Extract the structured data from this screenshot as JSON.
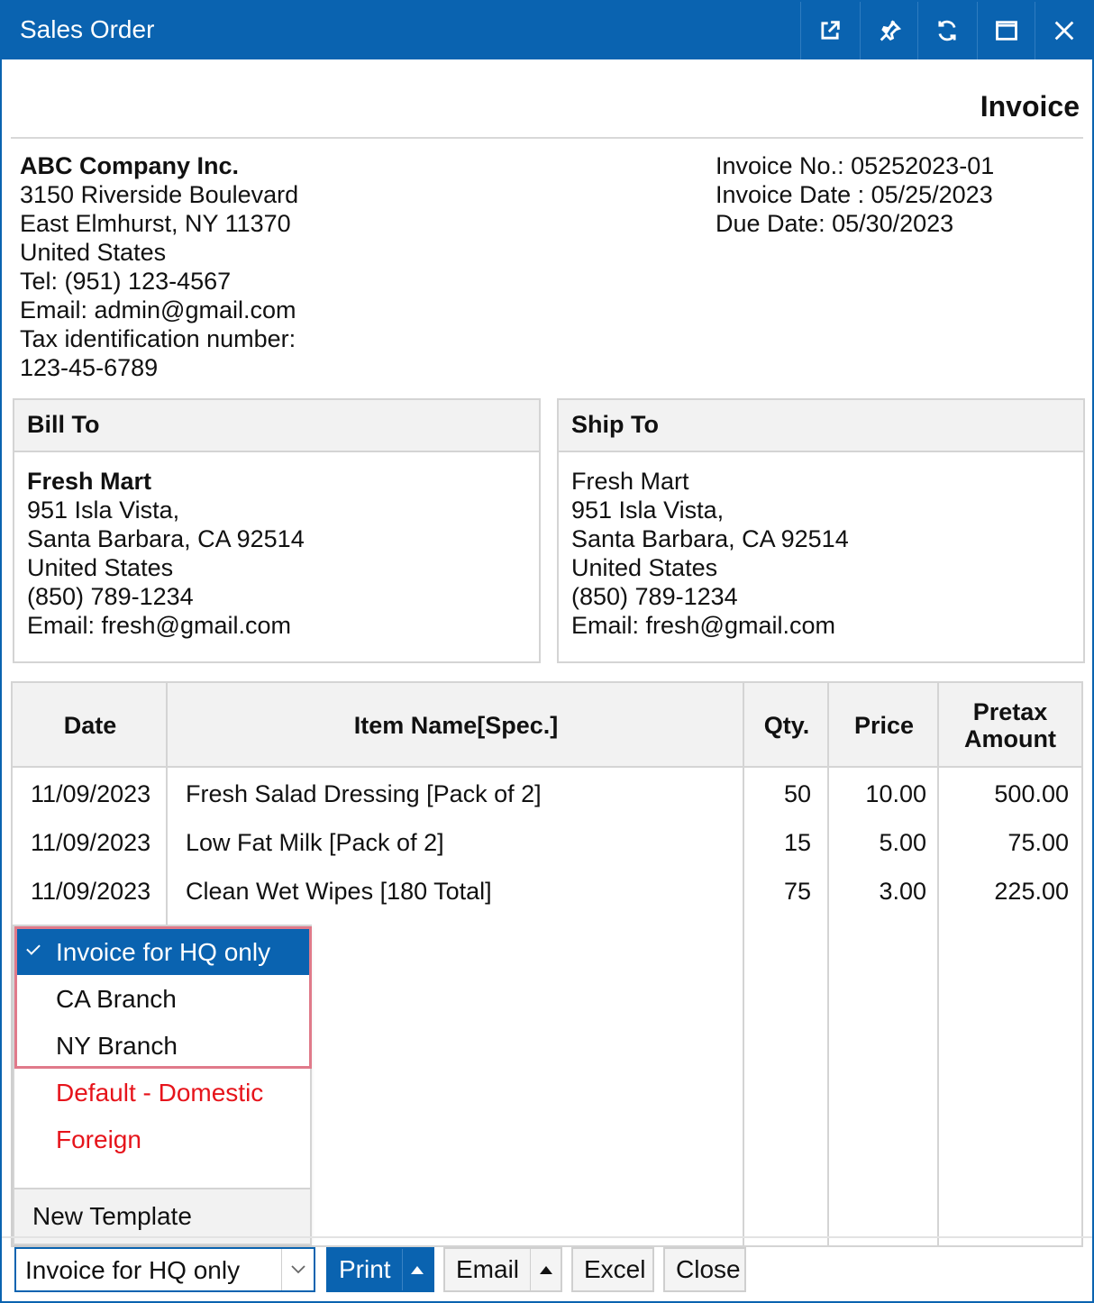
{
  "window": {
    "title": "Sales Order"
  },
  "document": {
    "title": "Invoice"
  },
  "company": {
    "name": "ABC Company Inc.",
    "lines": [
      "3150 Riverside Boulevard",
      "East Elmhurst, NY 11370",
      "United States",
      "Tel: (951) 123-4567",
      "Email: admin@gmail.com",
      "Tax identification number:",
      "123-45-6789"
    ]
  },
  "invoice_info": [
    "Invoice No.: 05252023-01",
    "Invoice Date : 05/25/2023",
    "Due Date: 05/30/2023"
  ],
  "bill_to": {
    "header": "Bill To",
    "name": "Fresh Mart",
    "lines": [
      "951 Isla Vista,",
      "Santa Barbara, CA 92514",
      "United States",
      "(850) 789-1234",
      "Email: fresh@gmail.com"
    ]
  },
  "ship_to": {
    "header": "Ship To",
    "name": "Fresh Mart",
    "lines": [
      "951 Isla Vista,",
      "Santa Barbara, CA 92514",
      "United States",
      "(850) 789-1234",
      "Email: fresh@gmail.com"
    ]
  },
  "table": {
    "headers": [
      "Date",
      "Item Name[Spec.]",
      "Qty.",
      "Price",
      "Pretax",
      "Amount"
    ],
    "rows": [
      [
        "11/09/2023",
        "Fresh Salad Dressing [Pack of 2]",
        "50",
        "10.00",
        "500.00"
      ],
      [
        "11/09/2023",
        "Low Fat Milk [Pack of 2]",
        "15",
        "5.00",
        "75.00"
      ],
      [
        "11/09/2023",
        "Clean Wet Wipes [180 Total]",
        "75",
        "3.00",
        "225.00"
      ]
    ]
  },
  "template_menu": {
    "items": [
      "Invoice for HQ only",
      "CA Branch",
      "NY Branch",
      "Default - Domestic",
      "Foreign"
    ],
    "new_template": "New Template",
    "colors": {
      "selected_bg": "#0a63b0",
      "red_text": "#e6141b"
    }
  },
  "footer": {
    "template_select": "Invoice for HQ only",
    "print": "Print",
    "email": "Email",
    "excel": "Excel",
    "close": "Close"
  },
  "colors": {
    "accent": "#0a63b0"
  }
}
